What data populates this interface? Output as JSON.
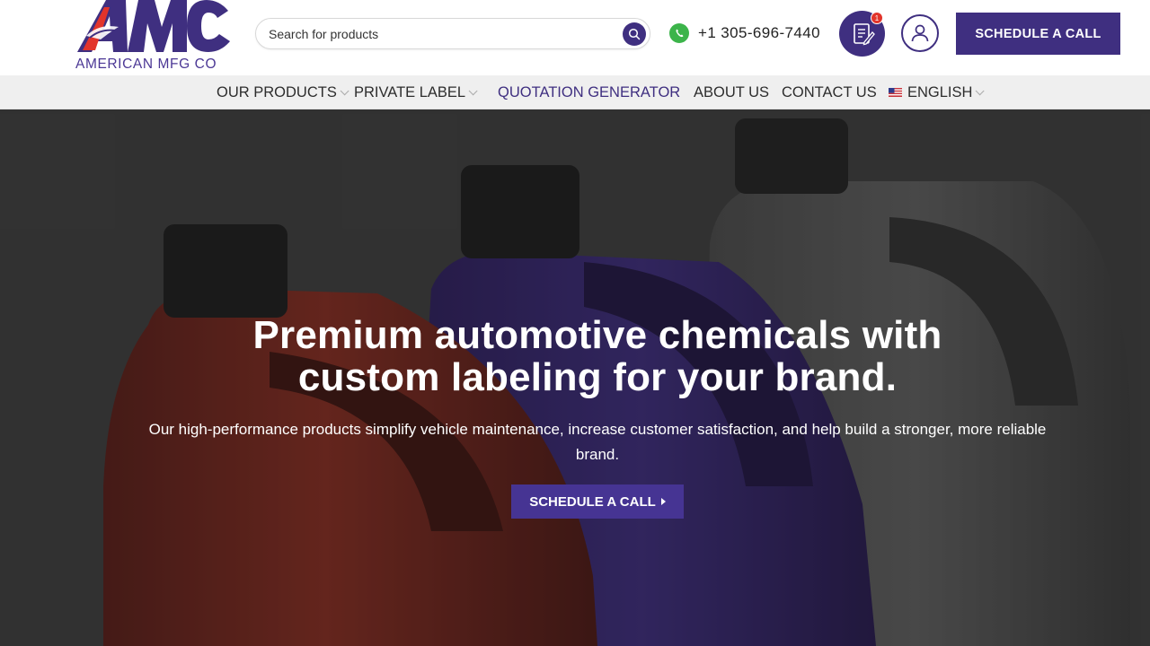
{
  "brand": {
    "logo_letters": "AMC",
    "name": "AMERICAN MFG CO",
    "primary_color": "#3f2f80",
    "accent_red": "#e2342b"
  },
  "header": {
    "search": {
      "placeholder": "Search for products",
      "icon": "search-icon"
    },
    "phone": {
      "icon": "whatsapp-icon",
      "number": "+1 305-696-7440"
    },
    "quote_icon": {
      "icon": "quote-document-icon",
      "badge": "1"
    },
    "account_icon": "user-icon",
    "schedule_label": "SCHEDULE A CALL"
  },
  "nav": {
    "items": [
      {
        "label": "OUR PRODUCTS",
        "has_dropdown": true
      },
      {
        "label": "PRIVATE LABEL",
        "has_dropdown": true
      },
      {
        "label": "QUOTATION GENERATOR",
        "active": true
      },
      {
        "label": "ABOUT US"
      },
      {
        "label": "CONTACT US"
      },
      {
        "label": "ENGLISH",
        "has_dropdown": true,
        "icon": "us-flag-icon"
      }
    ]
  },
  "hero": {
    "title_line1": "Premium automotive chemicals with",
    "title_line2": "custom labeling for your brand.",
    "subtitle": "Our high-performance products simplify vehicle maintenance, increase customer satisfaction, and help build a stronger, more reliable brand.",
    "cta_label": "SCHEDULE A CALL",
    "bottle_colors": [
      "#7a1f1a",
      "#3a2478",
      "#5a5a5a"
    ]
  }
}
